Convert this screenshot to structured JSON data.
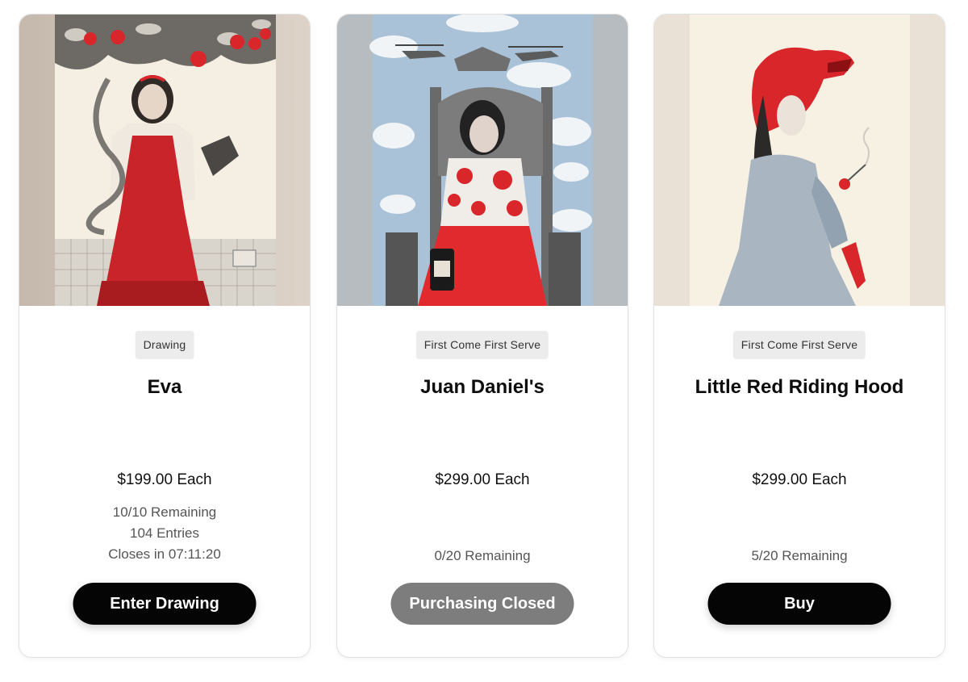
{
  "cards": [
    {
      "category": "Drawing",
      "title": "Eva",
      "price": "$199.00 Each",
      "details": [
        "10/10 Remaining",
        "104 Entries",
        "Closes in 07:11:20"
      ],
      "button": "Enter Drawing",
      "button_state": "enabled"
    },
    {
      "category": "First Come First Serve",
      "title": "Juan Daniel's",
      "price": "$299.00 Each",
      "details": [
        "0/20 Remaining"
      ],
      "button": "Purchasing Closed",
      "button_state": "disabled"
    },
    {
      "category": "First Come First Serve",
      "title": "Little Red Riding Hood",
      "price": "$299.00 Each",
      "details": [
        "5/20 Remaining"
      ],
      "button": "Buy",
      "button_state": "enabled"
    }
  ],
  "colors": {
    "accent_red": "#d8262b",
    "button_dark": "#050505",
    "button_disabled": "#7d7d7d",
    "badge_bg": "#ececec"
  }
}
